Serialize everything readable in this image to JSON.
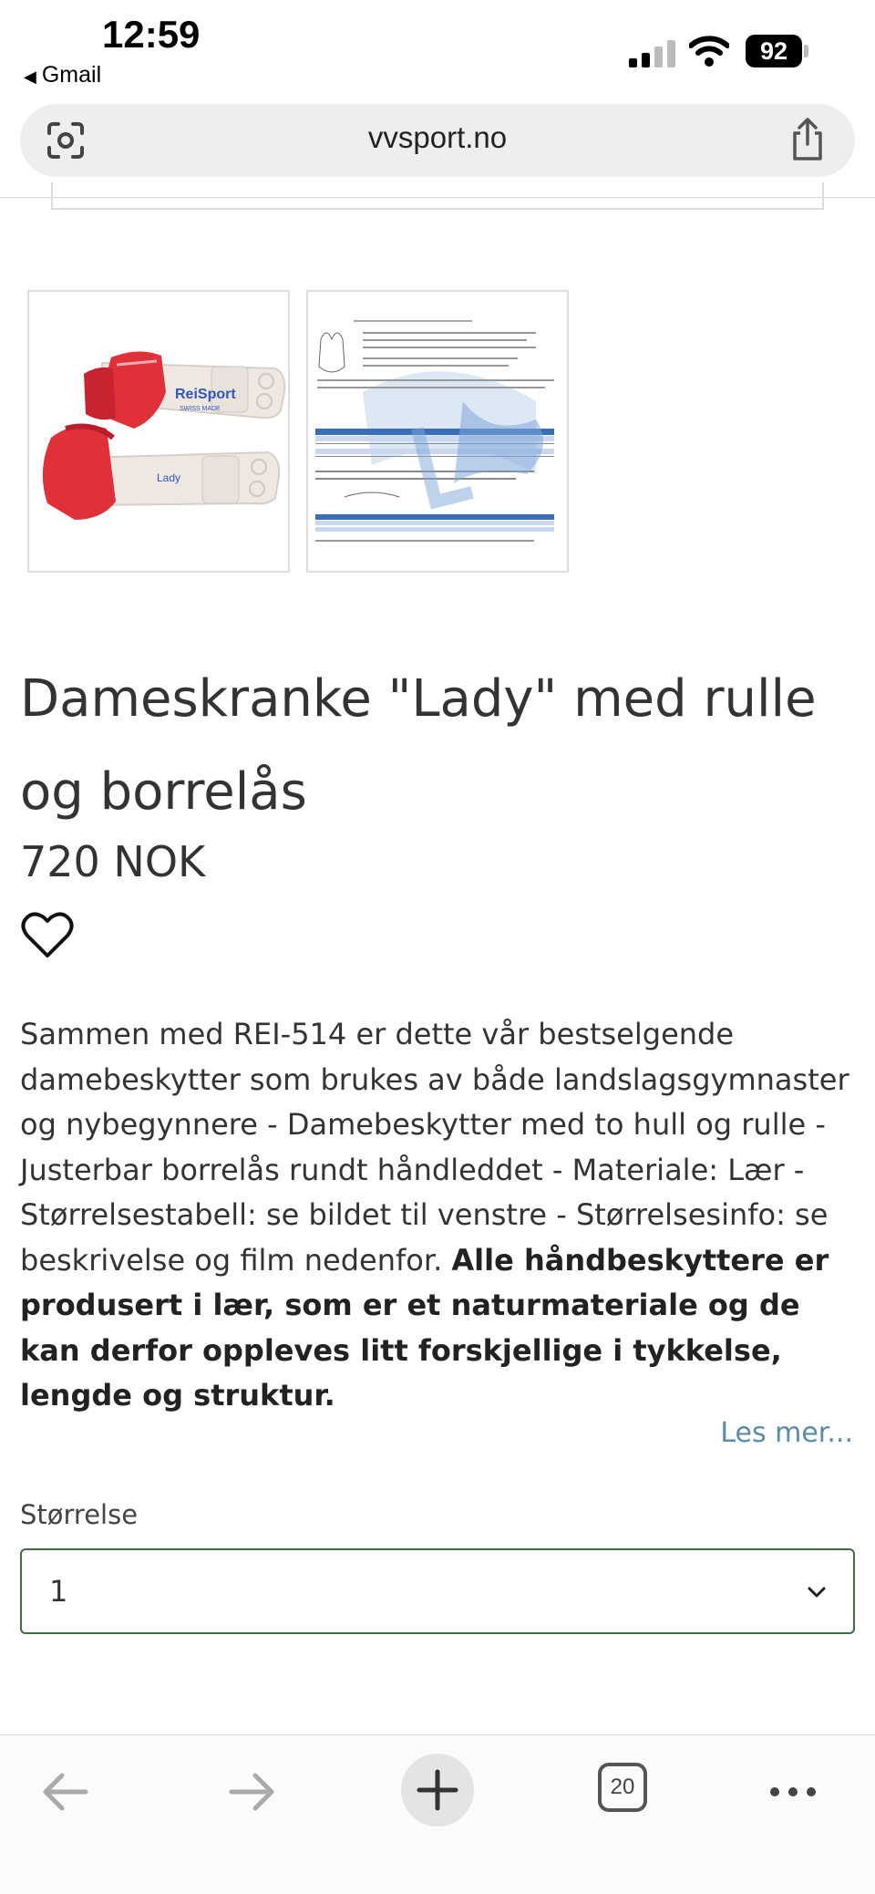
{
  "status_bar": {
    "time": "12:59",
    "back_app": "Gmail",
    "battery": "92"
  },
  "browser": {
    "url": "vvsport.no",
    "tab_count": "20"
  },
  "product": {
    "title": "Dameskranke \"Lady\" med rulle og borrelås",
    "price": "720 NOK",
    "description_plain": "Sammen med REI-514 er dette vår bestselgende damebeskytter som brukes av både landslagsgymnaster og nybegynnere - Damebeskytter med to hull og rulle - Justerbar borrelås rundt håndleddet - Materiale: Lær - Størrelsestabell: se bildet til venstre - Størrelsesinfo: se beskrivelse og film nedenfor.",
    "description_bold": "Alle håndbeskyttere er produsert i lær, som er et naturmateriale og de kan derfor oppleves litt forskjellige i tykkelse, lengde og struktur.",
    "read_more": "Les mer...",
    "size_label": "Størrelse",
    "size_value": "1",
    "thumbnail_brand": "ReiSport",
    "thumbnail_sub": "SWISS MADE",
    "thumbnail_model": "Lady"
  },
  "icons": {
    "heart": "heart-icon",
    "share": "share-icon",
    "tab_settings": "tab-settings-icon",
    "back": "arrow-left-icon",
    "forward": "arrow-right-icon",
    "new_tab": "plus-icon",
    "more": "more-dots-icon"
  }
}
